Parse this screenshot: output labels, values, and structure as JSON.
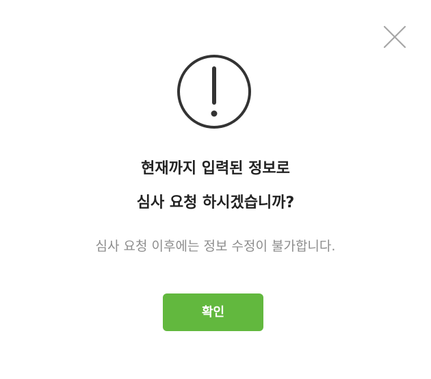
{
  "dialog": {
    "title_line1": "현재까지 입력된 정보로",
    "title_line2": "심사 요청 하시겠습니까?",
    "message": "심사 요청 이후에는 정보 수정이 불가합니다.",
    "confirm_label": "확인",
    "icons": {
      "close": "close-icon",
      "alert": "exclamation-circle-icon"
    },
    "colors": {
      "confirm_button": "#62b83e",
      "title_text": "#222222",
      "message_text": "#8d8d8d",
      "icon_stroke": "#333333",
      "close_icon": "#a6a6a6"
    }
  }
}
